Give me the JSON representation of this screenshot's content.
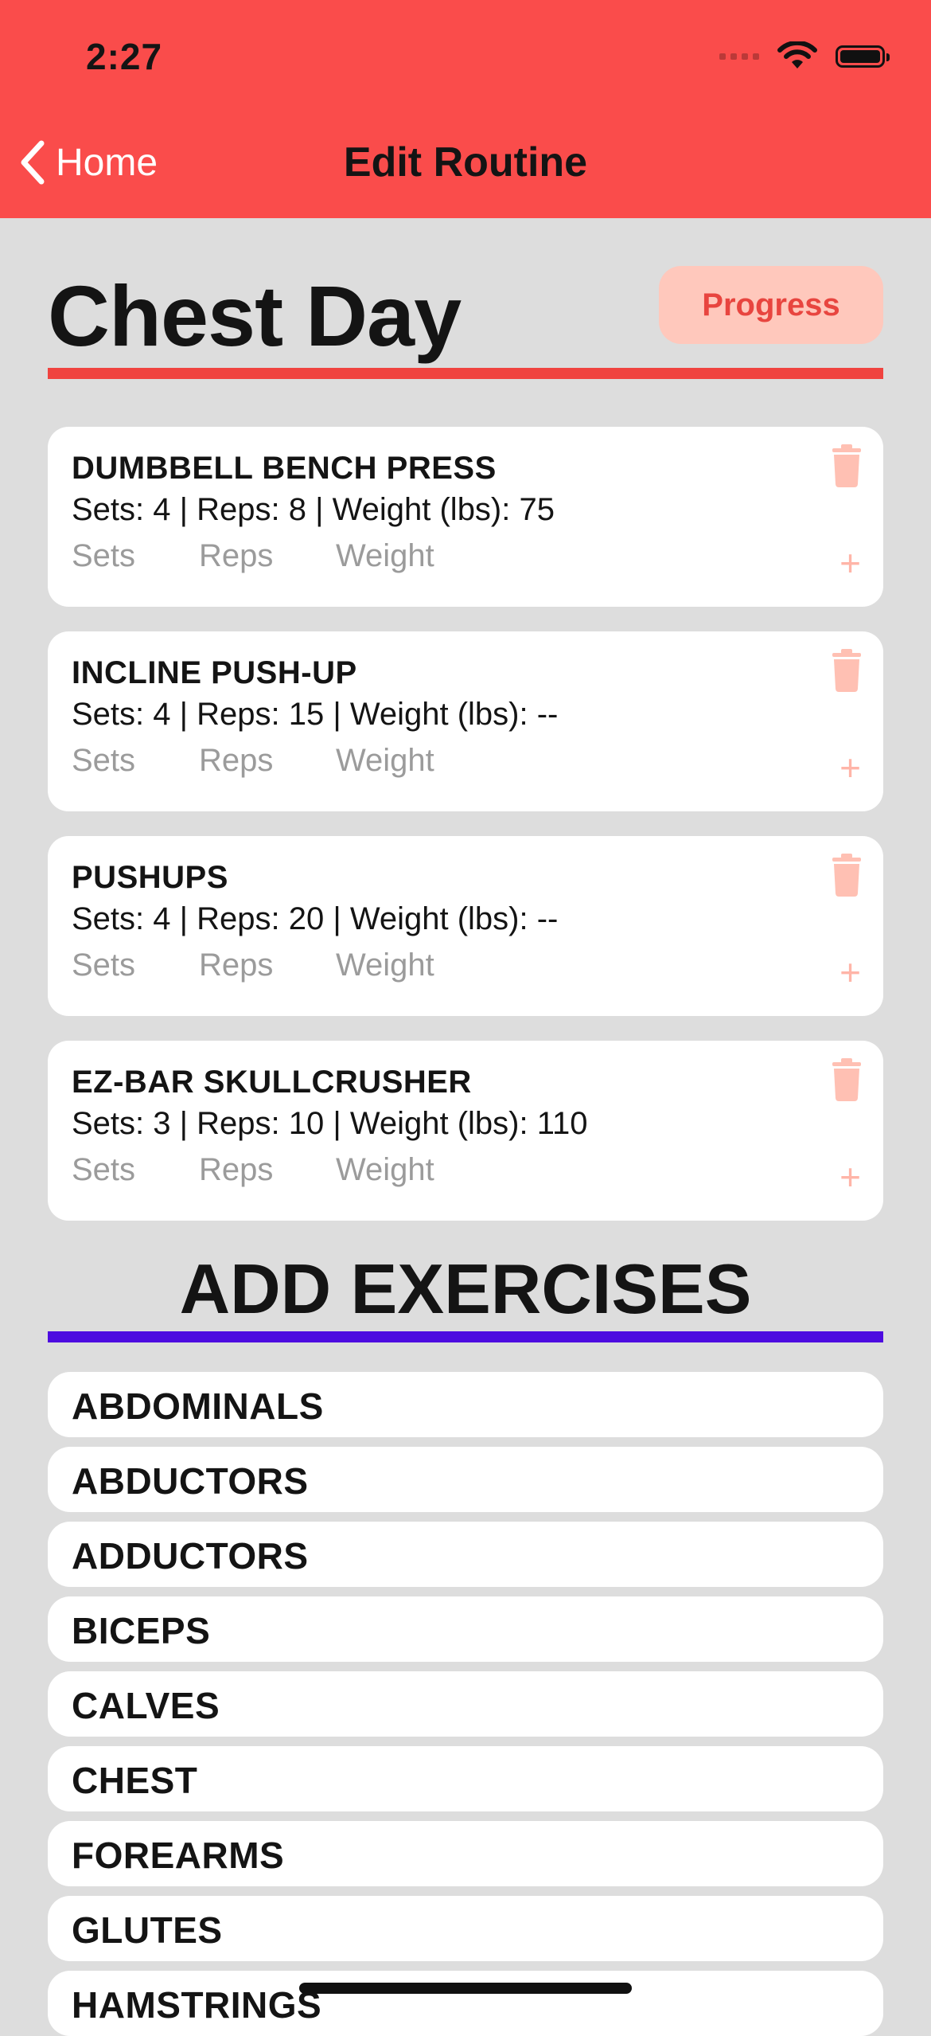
{
  "status_bar": {
    "time": "2:27",
    "icons": [
      "signal-icon",
      "wifi-icon",
      "battery-icon"
    ]
  },
  "nav": {
    "back_label": "Home",
    "title": "Edit Routine"
  },
  "routine": {
    "title": "Chest Day",
    "progress_label": "Progress"
  },
  "exercises": [
    {
      "name": "DUMBBELL BENCH PRESS",
      "summary": "Sets: 4 | Reps: 8 | Weight (lbs): 75"
    },
    {
      "name": "INCLINE PUSH-UP",
      "summary": "Sets: 4 | Reps: 15 | Weight (lbs): --"
    },
    {
      "name": "PUSHUPS",
      "summary": "Sets: 4 | Reps: 20 | Weight (lbs): --"
    },
    {
      "name": "EZ-BAR SKULLCRUSHER",
      "summary": "Sets: 3 | Reps: 10 | Weight (lbs): 110"
    }
  ],
  "exercise_inputs": {
    "sets_placeholder": "Sets",
    "reps_placeholder": "Reps",
    "weight_placeholder": "Weight",
    "add_symbol": "+"
  },
  "add_section": {
    "title": "ADD EXERCISES",
    "muscle_groups": [
      "ABDOMINALS",
      "ABDUCTORS",
      "ADDUCTORS",
      "BICEPS",
      "CALVES",
      "CHEST",
      "FOREARMS",
      "GLUTES",
      "HAMSTRINGS"
    ]
  },
  "colors": {
    "header": "#fa4c4b",
    "accent_red": "#f0433f",
    "accent_purple": "#4d0be0",
    "progress_bg": "#ffc8bc",
    "background": "#dddddd"
  }
}
